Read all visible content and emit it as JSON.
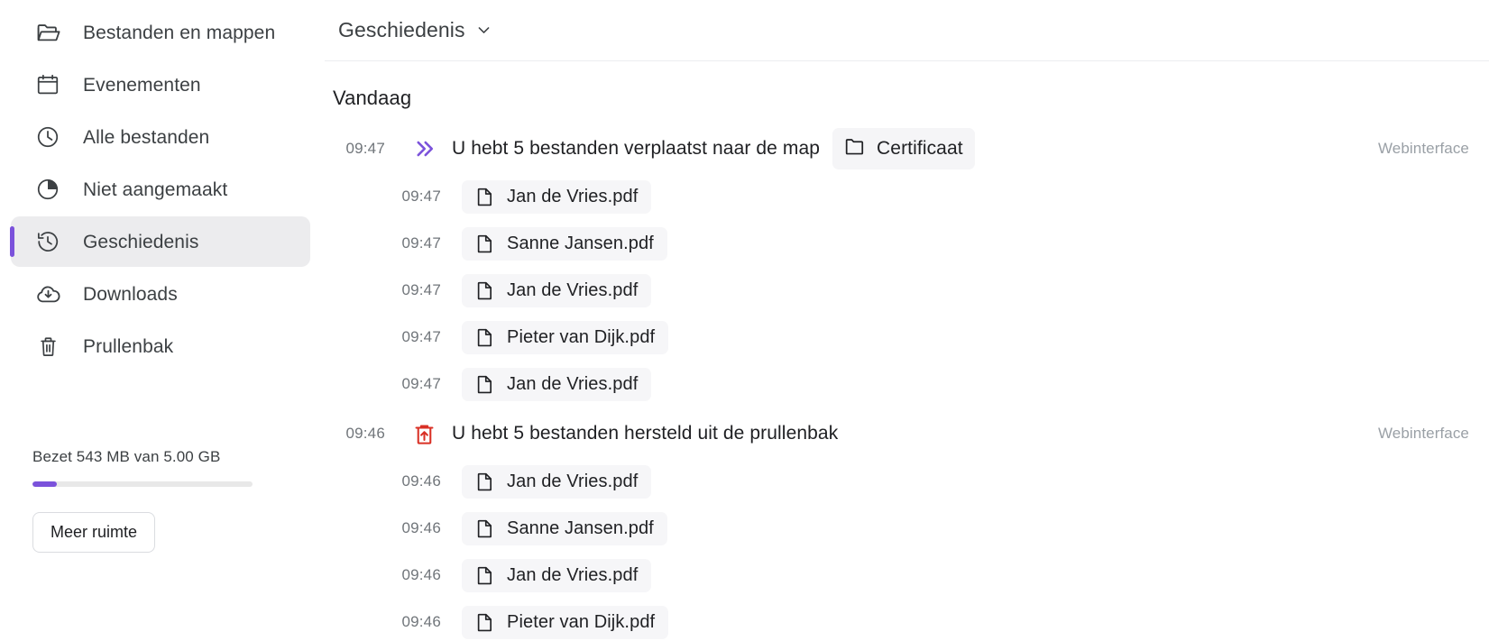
{
  "sidebar": {
    "items": [
      {
        "label": "Bestanden en mappen",
        "icon": "folder-open-icon",
        "active": false
      },
      {
        "label": "Evenementen",
        "icon": "calendar-icon",
        "active": false
      },
      {
        "label": "Alle bestanden",
        "icon": "clock-icon",
        "active": false
      },
      {
        "label": "Niet aangemaakt",
        "icon": "pie-chart-icon",
        "active": false
      },
      {
        "label": "Geschiedenis",
        "icon": "history-icon",
        "active": true
      },
      {
        "label": "Downloads",
        "icon": "cloud-download-icon",
        "active": false
      },
      {
        "label": "Prullenbak",
        "icon": "trash-icon",
        "active": false
      }
    ],
    "storage": {
      "text": "Bezet 543 MB van 5.00 GB",
      "used_label": "543 MB",
      "total_label": "5.00 GB",
      "percent": 11,
      "fill_color": "#7b52db",
      "button_label": "Meer ruimte"
    },
    "accent_color": "#7b52db"
  },
  "main": {
    "header": {
      "title": "Geschiedenis",
      "chevron": "chevron-down-icon"
    },
    "section_title": "Vandaag",
    "groups": [
      {
        "time": "09:47",
        "icon": "double-chevron-right-icon",
        "icon_color": "#7b52db",
        "text": "U hebt 5 bestanden verplaatst naar de map",
        "chip": {
          "label": "Certificaat",
          "icon": "folder-icon"
        },
        "source": "Webinterface",
        "files": [
          {
            "time": "09:47",
            "name": "Jan de Vries.pdf",
            "icon": "document-icon"
          },
          {
            "time": "09:47",
            "name": "Sanne Jansen.pdf",
            "icon": "document-icon"
          },
          {
            "time": "09:47",
            "name": "Jan de Vries.pdf",
            "icon": "document-icon"
          },
          {
            "time": "09:47",
            "name": "Pieter van Dijk.pdf",
            "icon": "document-icon"
          },
          {
            "time": "09:47",
            "name": "Jan de Vries.pdf",
            "icon": "document-icon"
          }
        ]
      },
      {
        "time": "09:46",
        "icon": "trash-restore-icon",
        "icon_color": "#d93025",
        "text": "U hebt 5 bestanden hersteld uit de prullenbak",
        "chip": null,
        "source": "Webinterface",
        "files": [
          {
            "time": "09:46",
            "name": "Jan de Vries.pdf",
            "icon": "document-icon"
          },
          {
            "time": "09:46",
            "name": "Sanne Jansen.pdf",
            "icon": "document-icon"
          },
          {
            "time": "09:46",
            "name": "Jan de Vries.pdf",
            "icon": "document-icon"
          },
          {
            "time": "09:46",
            "name": "Pieter van Dijk.pdf",
            "icon": "document-icon"
          }
        ]
      }
    ]
  }
}
